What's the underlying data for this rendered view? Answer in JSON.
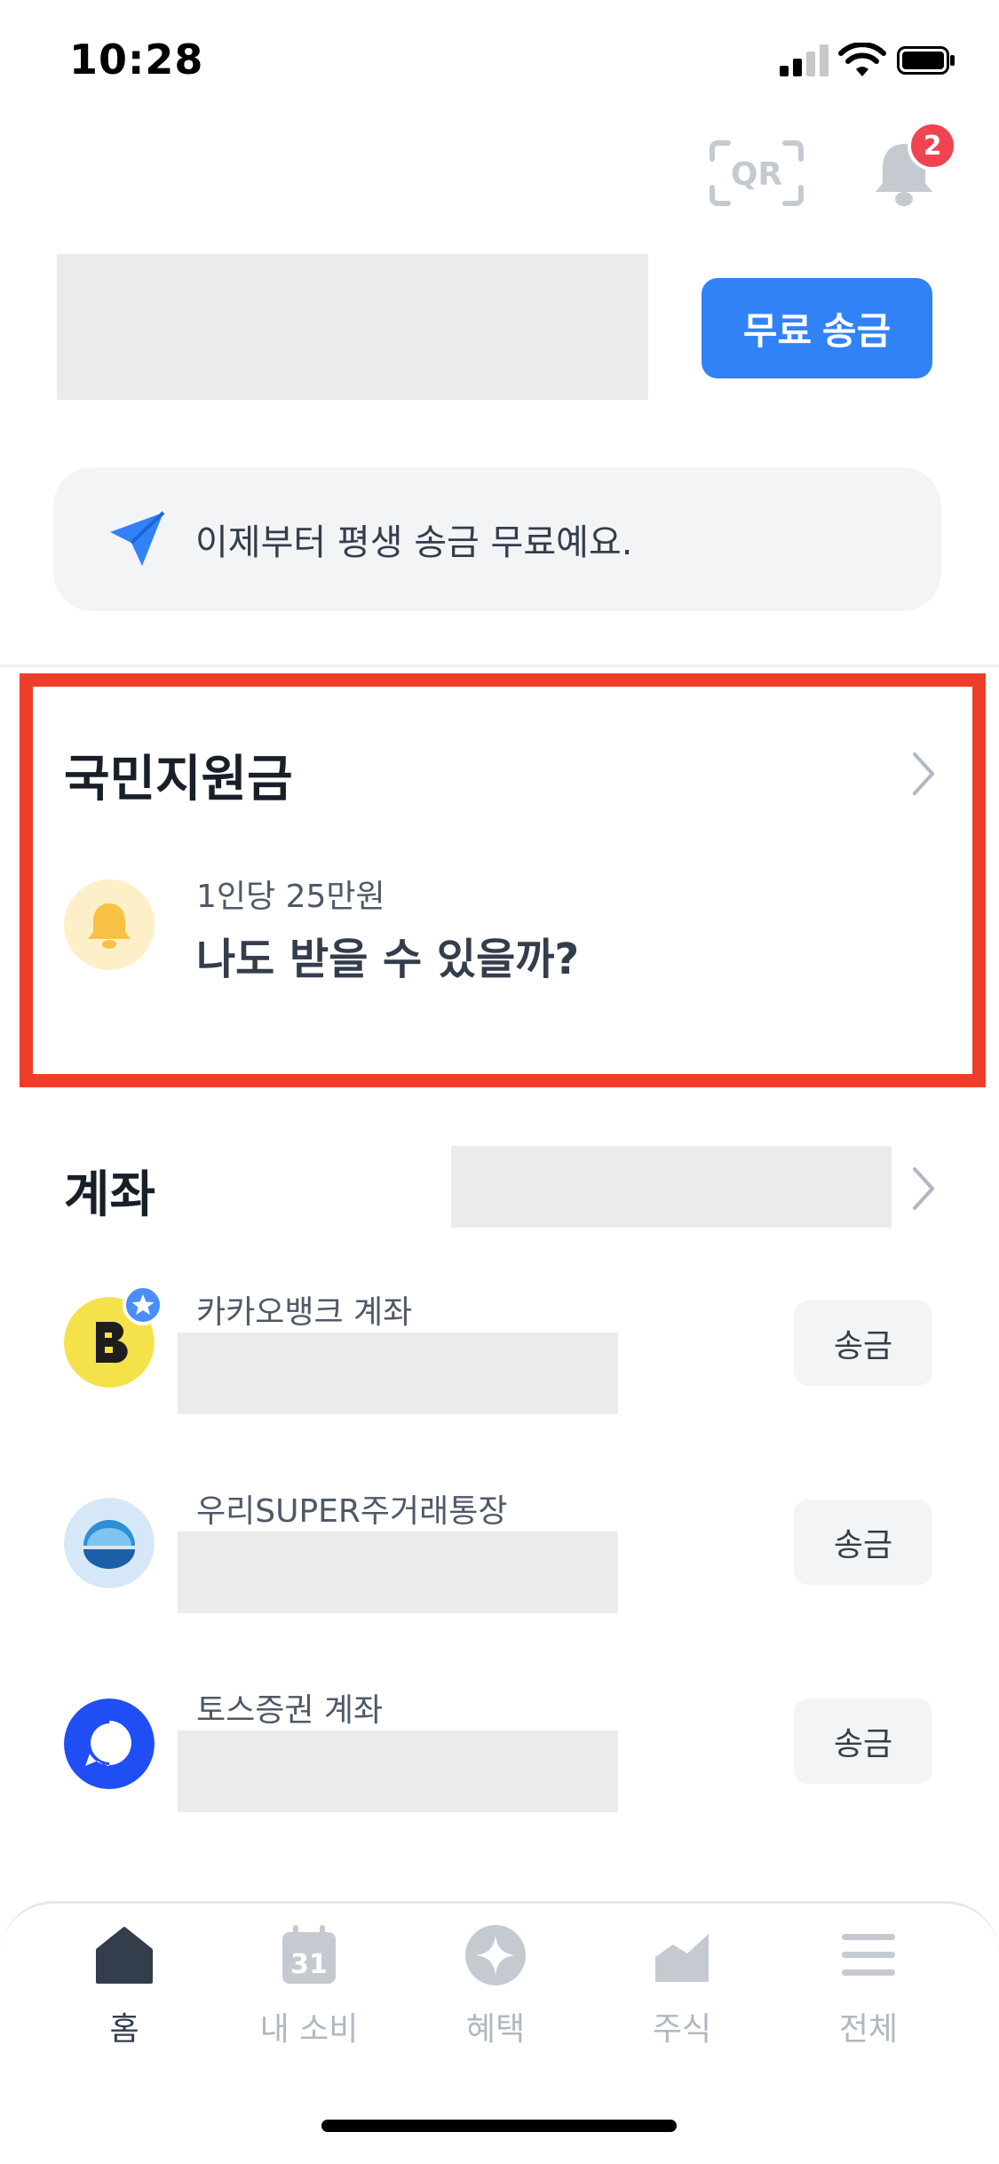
{
  "status_bar": {
    "time": "10:28"
  },
  "header": {
    "qr_label": "QR",
    "notification_count": "2"
  },
  "transfer": {
    "button_label": "무료 송금"
  },
  "promo": {
    "text": "이제부터 평생 송금 무료예요."
  },
  "support": {
    "title": "국민지원금",
    "caption": "1인당 25만원",
    "question": "나도 받을 수 있을까?"
  },
  "accounts": {
    "title": "계좌",
    "items": [
      {
        "name": "카카오뱅크 계좌",
        "action": "송금"
      },
      {
        "name": "우리SUPER주거래통장",
        "action": "송금"
      },
      {
        "name": "토스증권 계좌",
        "action": "송금"
      }
    ]
  },
  "tabbar": {
    "tabs": [
      {
        "label": "홈"
      },
      {
        "label": "내 소비",
        "icon_text": "31"
      },
      {
        "label": "혜택"
      },
      {
        "label": "주식"
      },
      {
        "label": "전체"
      }
    ],
    "active": "홈"
  },
  "colors": {
    "accent": "#3182f6",
    "badge": "#f04452",
    "highlight_border": "#ee3e2a",
    "kakao_yellow": "#fae100",
    "toss_blue": "#1f4ef5"
  },
  "icons": {
    "status": [
      "signal-icon",
      "wifi-icon",
      "battery-icon"
    ],
    "header": [
      "qr-icon",
      "bell-icon"
    ],
    "promo": "paper-plane-icon",
    "support": "bell-icon",
    "tabs": [
      "home-icon",
      "calendar-icon",
      "sparkle-icon",
      "chart-icon",
      "menu-icon"
    ]
  }
}
